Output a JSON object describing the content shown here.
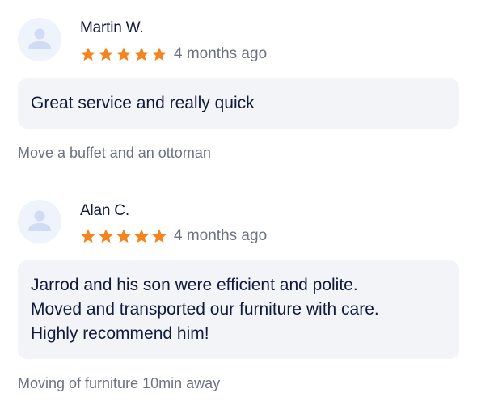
{
  "reviews": [
    {
      "name": "Martin W.",
      "rating": 5,
      "time": "4 months ago",
      "text_lines": [
        "Great service and really quick"
      ],
      "service": "Move a buffet and an ottoman"
    },
    {
      "name": "Alan C.",
      "rating": 5,
      "time": "4 months ago",
      "text_lines": [
        "Jarrod and his son were efficient and polite.",
        "Moved and transported our furniture with care.",
        "Highly recommend him!"
      ],
      "service": "Moving of furniture 10min away"
    }
  ],
  "colors": {
    "star": "#f5841f",
    "avatar_bg": "#eef3fc",
    "avatar_fg": "#cfdcf3",
    "bubble_bg": "#f3f4f8"
  },
  "icons": {
    "avatar": "user-avatar-icon",
    "star": "star-icon"
  }
}
